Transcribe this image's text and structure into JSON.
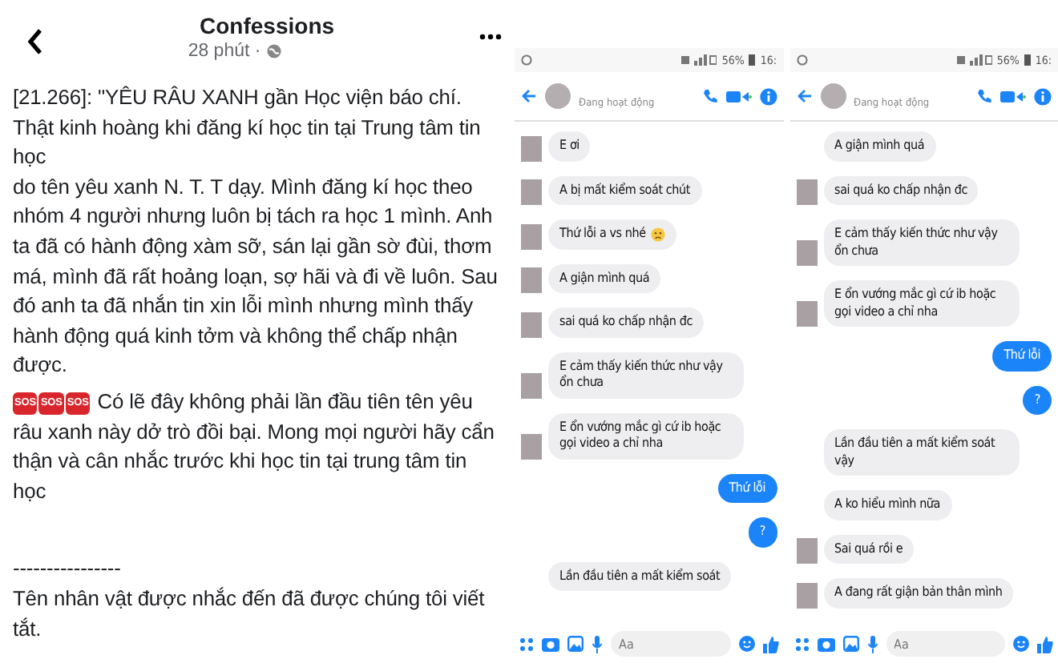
{
  "post": {
    "title": "Confessions",
    "time": "28 phút ·",
    "paragraphs": [
      {
        "kind": "text",
        "text": "[21.266]: \"YÊU RÂU XANH gần Học viện báo chí. Thật kinh hoàng khi đăng kí học tin tại Trung tâm tin học"
      },
      {
        "kind": "text",
        "text": "do tên yêu xanh N. T. T dạy. Mình đăng kí học theo nhóm 4 người nhưng luôn bị tách ra học 1 mình. Anh ta đã có hành động xàm sỡ, sán lại gần sờ đùi, thơm má, mình đã rất hoảng loạn, sợ hãi và đi về luôn. Sau đó anh ta đã nhắn tin xin lỗi mình nhưng mình thấy hành động quá kinh tởm và không thể chấp nhận được."
      },
      {
        "kind": "alert",
        "badges": [
          "SOS",
          "SOS",
          "SOS"
        ],
        "text": "Có lẽ đây không phải lần đầu tiên tên yêu râu xanh này dở trò đồi  bại. Mong mọi người hãy cẩn thận và cân nhắc trước khi học tin tại trung tâm tin học"
      },
      {
        "kind": "gap"
      },
      {
        "kind": "text",
        "text": "----------------"
      },
      {
        "kind": "text",
        "text": "Tên nhân vật được nhắc đến đã được chúng tôi viết tắt."
      }
    ]
  },
  "phones": [
    {
      "battery": "56%",
      "time": "16:",
      "contact_status": "Đang hoạt động",
      "composer_placeholder": "Aa",
      "messages": [
        {
          "kind": "incoming",
          "avatar": true,
          "text": "E ơi"
        },
        {
          "kind": "incoming",
          "avatar": true,
          "text": "A bị mất kiểm soát chút"
        },
        {
          "kind": "incoming",
          "avatar": true,
          "text": "Thứ lỗi a vs nhé",
          "sticker": true
        },
        {
          "kind": "incoming",
          "avatar": true,
          "text": "A giận mình quá"
        },
        {
          "kind": "incoming",
          "avatar": true,
          "text": "sai quá ko chấp nhận đc"
        },
        {
          "kind": "incoming",
          "avatar": true,
          "text": "E cảm thấy kiến thức như vậy ổn chưa"
        },
        {
          "kind": "incoming",
          "avatar": true,
          "text": "E ổn vướng mắc gì cứ ib hoặc gọi video a chỉ nha"
        },
        {
          "kind": "outgoing",
          "text": "Thứ lỗi"
        },
        {
          "kind": "outgoing",
          "text": "?"
        },
        {
          "kind": "incoming",
          "avatar": false,
          "text": "Lần đầu tiên a mất kiểm soát"
        }
      ]
    },
    {
      "battery": "56%",
      "time": "16:",
      "contact_status": "Đang hoạt động",
      "composer_placeholder": "Aa",
      "messages": [
        {
          "kind": "incoming",
          "avatar": false,
          "text": "A giận mình quá"
        },
        {
          "kind": "incoming",
          "avatar": true,
          "text": "sai quá ko chấp nhận đc"
        },
        {
          "kind": "incoming",
          "avatar": true,
          "text": "E cảm thấy kiến thức như vậy ổn chưa"
        },
        {
          "kind": "incoming",
          "avatar": true,
          "text": "E ổn vướng mắc gì cứ ib hoặc gọi video a chỉ nha"
        },
        {
          "kind": "outgoing",
          "text": "Thứ lỗi"
        },
        {
          "kind": "outgoing",
          "text": "?"
        },
        {
          "kind": "incoming",
          "avatar": false,
          "text": "Lần đầu tiên a mất kiểm soát vậy"
        },
        {
          "kind": "incoming",
          "avatar": false,
          "text": "A ko hiểu mình nữa"
        },
        {
          "kind": "incoming",
          "avatar": true,
          "text": "Sai quá rồi e"
        },
        {
          "kind": "incoming",
          "avatar": true,
          "text": "A đang rất giận bản thân mình"
        }
      ]
    }
  ]
}
